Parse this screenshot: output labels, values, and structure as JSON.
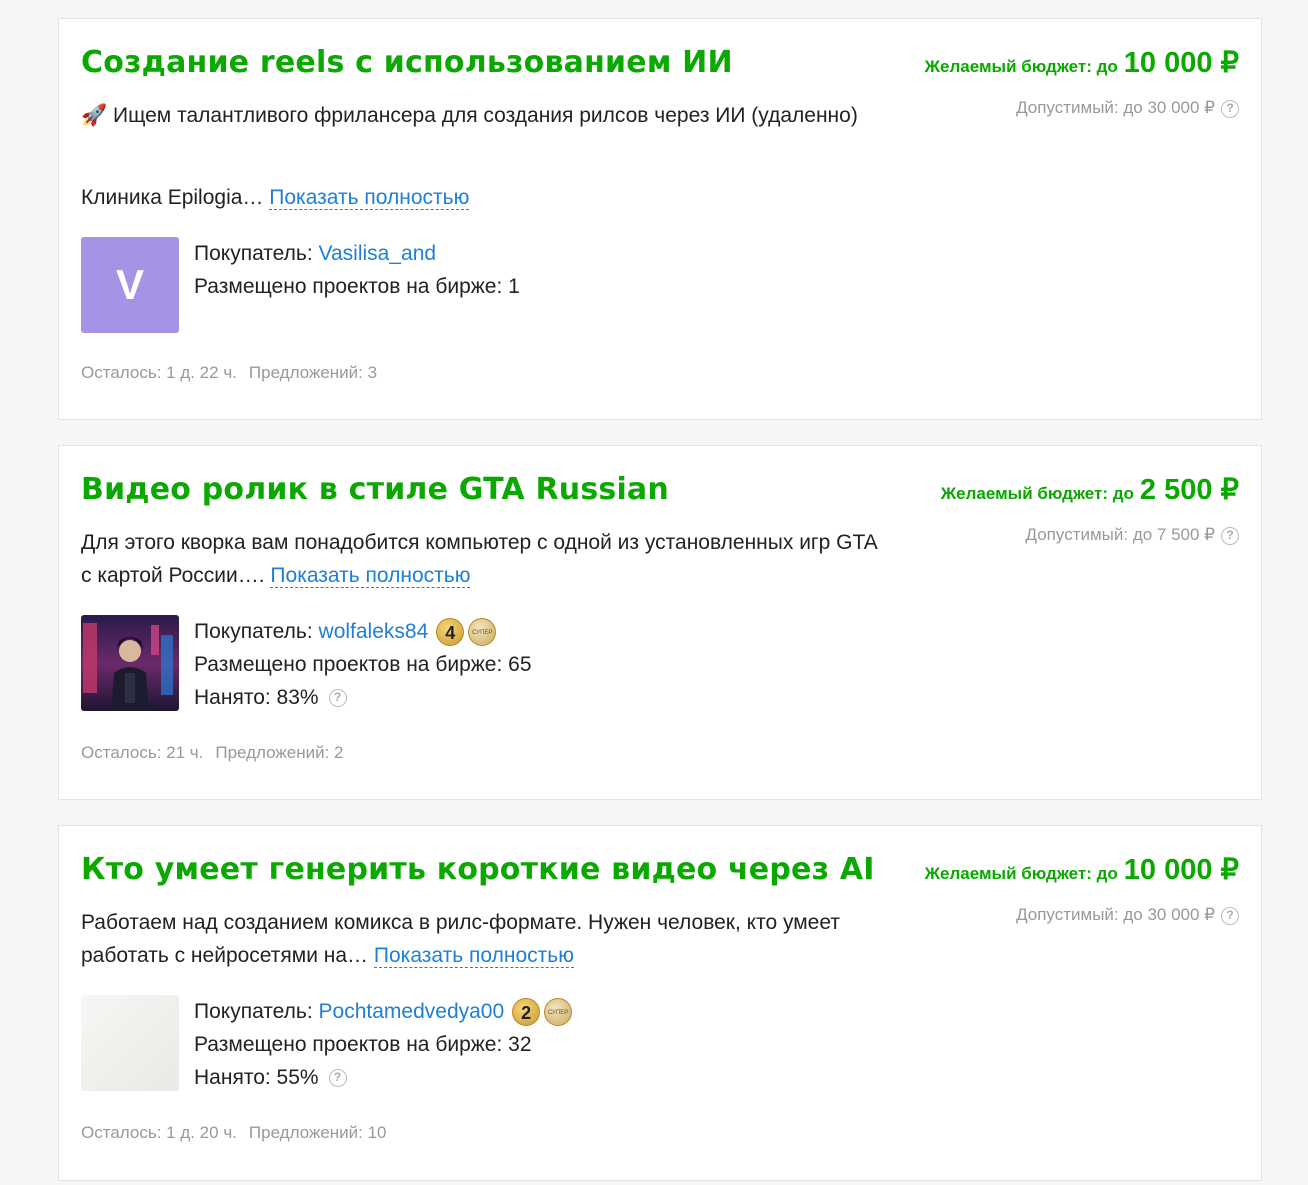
{
  "projects": [
    {
      "title": "Создание reels с использованием ИИ",
      "budget_label": "Желаемый бюджет: до",
      "budget_amount": "10 000 ₽",
      "allowed": "Допустимый: до 30 000 ₽",
      "desc_line1": "🚀  Ищем талантливого фрилансера для создания рилсов через ИИ (удаленно)",
      "desc_line2": "Клиника Epilogia…",
      "show_more": "Показать полностью",
      "buyer_label": "Покупатель:",
      "buyer_name": "Vasilisa_and",
      "avatar_letter": "V",
      "projects_posted": "Размещено проектов на бирже: 1",
      "time_left": "Осталось: 1 д. 22 ч.",
      "offers": "Предложений: 3"
    },
    {
      "title": "Видео ролик в стиле GTA Russian",
      "budget_label": "Желаемый бюджет: до",
      "budget_amount": "2 500 ₽",
      "allowed": "Допустимый: до 7 500 ₽",
      "desc": "Для этого кворка вам понадобится компьютер с одной из установленных игр GTA с картой России….",
      "show_more": "Показать полностью",
      "buyer_label": "Покупатель:",
      "buyer_name": "wolfaleks84",
      "level": "4",
      "super_badge": "СУПЕР",
      "projects_posted": "Размещено проектов на бирже: 65",
      "hired": "Нанято: 83%",
      "time_left": "Осталось: 21 ч.",
      "offers": "Предложений: 2"
    },
    {
      "title": "Кто умеет генерить короткие видео через AI",
      "budget_label": "Желаемый бюджет: до",
      "budget_amount": "10 000 ₽",
      "allowed": "Допустимый: до 30 000 ₽",
      "desc": "Работаем над созданием комикса в рилс-формате. Нужен человек, кто умеет работать с нейросетями на…",
      "show_more": "Показать полностью",
      "buyer_label": "Покупатель:",
      "buyer_name": "Pochtamedvedya00",
      "level": "2",
      "super_badge": "СУПЕР",
      "projects_posted": "Размещено проектов на бирже: 32",
      "hired": "Нанято: 55%",
      "time_left": "Осталось: 1 д. 20 ч.",
      "offers": "Предложений: 10"
    }
  ],
  "help_glyph": "?",
  "colors": {
    "title_green": "#0aa800",
    "link_blue": "#1e7fd6",
    "muted": "#999999",
    "avatar_purple": "#a594e6"
  }
}
